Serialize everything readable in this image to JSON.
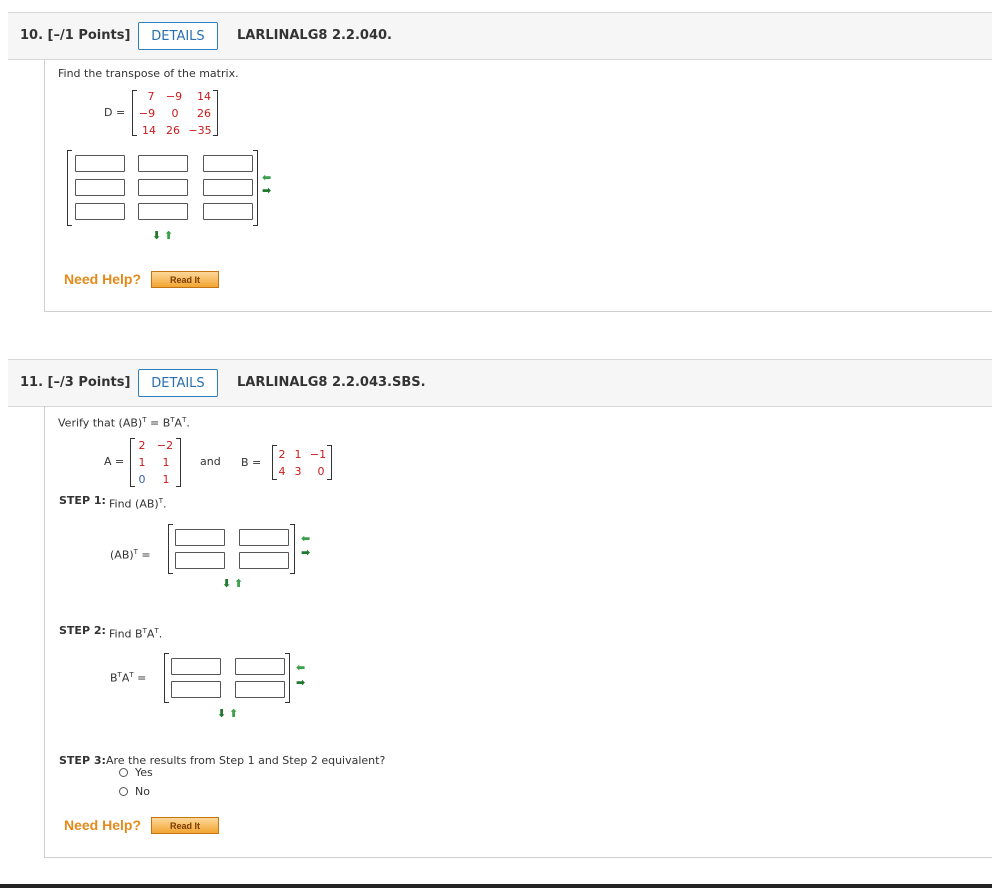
{
  "q10": {
    "number": "10.  [–/1 Points]",
    "details": "DETAILS",
    "id": "LARLINALG8 2.2.040.",
    "prompt": "Find the transpose of the matrix.",
    "matrix_label": "D =",
    "matrix": [
      [
        "7",
        "−9",
        "14"
      ],
      [
        "−9",
        "0",
        "26"
      ],
      [
        "14",
        "26",
        "−35"
      ]
    ],
    "help": "Need Help?",
    "read_it": "Read It"
  },
  "q11": {
    "number": "11.  [–/3 Points]",
    "details": "DETAILS",
    "id": "LARLINALG8 2.2.043.SBS.",
    "prompt_prefix": "Verify that (AB)",
    "prompt_mid": " = B",
    "prompt_mid2": "A",
    "sup_T": "T",
    "period": ".",
    "A_label": "A =",
    "A": [
      [
        "2",
        "−2"
      ],
      [
        "1",
        "1"
      ],
      [
        "0",
        "1"
      ]
    ],
    "and": "and",
    "B_label": "B =",
    "B": [
      [
        "2",
        "1",
        "−1"
      ],
      [
        "4",
        "3",
        "0"
      ]
    ],
    "step1_label": "STEP 1:",
    "step1_text": "Find (AB)",
    "step1_lhs": "(AB)",
    "eq": " =",
    "step2_label": "STEP 2:",
    "step2_text": "Find B",
    "step2_lhs_B": "B",
    "step2_lhs_A": "A",
    "step3_label": "STEP 3:",
    "step3_text": "Are the results from Step 1 and Step 2 equivalent?",
    "options": [
      "Yes",
      "No"
    ],
    "help": "Need Help?",
    "read_it": "Read It"
  },
  "icons": {
    "row_add": "left-right-arrows-icon",
    "col_add": "down-up-arrows-icon"
  }
}
